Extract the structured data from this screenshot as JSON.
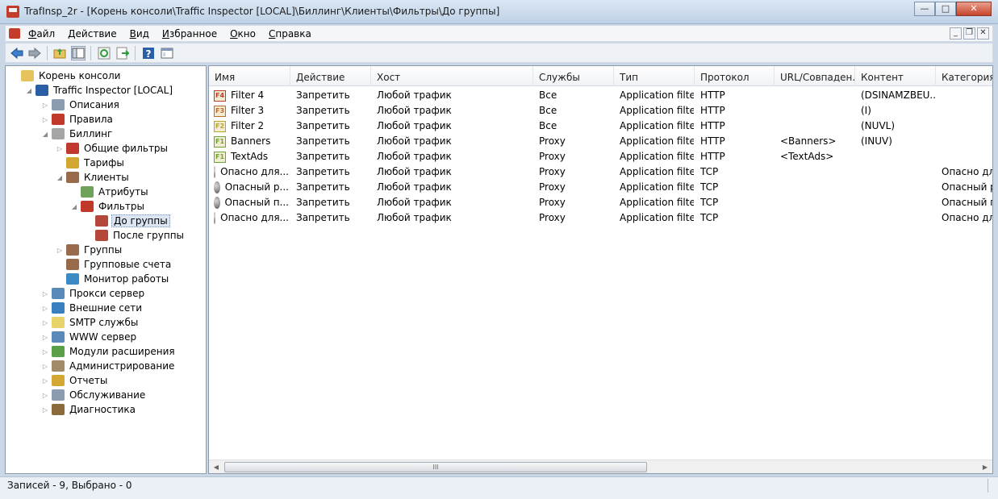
{
  "window": {
    "title": "TrafInsp_2r - [Корень консоли\\Traffic Inspector [LOCAL]\\Биллинг\\Клиенты\\Фильтры\\До группы]",
    "minimize": "—",
    "maximize": "□",
    "close": "✕"
  },
  "menu": {
    "items": [
      {
        "hot": "Ф",
        "rest": "айл"
      },
      {
        "hot": "Д",
        "rest": "ействие"
      },
      {
        "hot": "В",
        "rest": "ид"
      },
      {
        "hot": "И",
        "rest": "збранное"
      },
      {
        "hot": "О",
        "rest": "кно"
      },
      {
        "hot": "С",
        "rest": "правка"
      }
    ],
    "mdi_minimize": "_",
    "mdi_restore": "❐",
    "mdi_close": "✕"
  },
  "toolbar": {
    "icons": [
      "back-icon",
      "forward-icon",
      "up-folder-icon",
      "show-hide-tree-icon",
      "refresh-icon",
      "export-list-icon",
      "help-icon",
      "properties-icon"
    ]
  },
  "tree": {
    "nodes": [
      {
        "label": "Корень консоли",
        "icon": "folder-icon",
        "color": "#e7c35b"
      },
      {
        "label": "Traffic Inspector [LOCAL]",
        "icon": "traffic-inspector-icon",
        "color": "#2a5fa8"
      },
      {
        "label": "Описания",
        "icon": "descriptions-icon",
        "color": "#8c9bb0"
      },
      {
        "label": "Правила",
        "icon": "rules-icon",
        "color": "#c0392b"
      },
      {
        "label": "Биллинг",
        "icon": "billing-icon",
        "color": "#a5a5a5"
      },
      {
        "label": "Общие фильтры",
        "icon": "common-filters-icon",
        "color": "#c0392b"
      },
      {
        "label": "Тарифы",
        "icon": "tariffs-icon",
        "color": "#d4a733"
      },
      {
        "label": "Клиенты",
        "icon": "clients-icon",
        "color": "#9a6b4a"
      },
      {
        "label": "Атрибуты",
        "icon": "attributes-icon",
        "color": "#6fa35b"
      },
      {
        "label": "Фильтры",
        "icon": "filters-icon",
        "color": "#c0392b"
      },
      {
        "label": "До группы",
        "icon": "before-group-icon",
        "color": "#b5463a"
      },
      {
        "label": "После группы",
        "icon": "after-group-icon",
        "color": "#b5463a"
      },
      {
        "label": "Группы",
        "icon": "groups-icon",
        "color": "#9a6b4a"
      },
      {
        "label": "Групповые счета",
        "icon": "group-accounts-icon",
        "color": "#9a6b4a"
      },
      {
        "label": "Монитор работы",
        "icon": "monitor-icon",
        "color": "#3c8ac4"
      },
      {
        "label": "Прокси сервер",
        "icon": "proxy-server-icon",
        "color": "#5a8bb8"
      },
      {
        "label": "Внешние сети",
        "icon": "external-networks-icon",
        "color": "#3a7fc0"
      },
      {
        "label": "SMTP службы",
        "icon": "smtp-icon",
        "color": "#e8d26a"
      },
      {
        "label": "WWW сервер",
        "icon": "www-server-icon",
        "color": "#5a8bb8"
      },
      {
        "label": "Модули расширения",
        "icon": "extension-modules-icon",
        "color": "#5aa04a"
      },
      {
        "label": "Администрирование",
        "icon": "administration-icon",
        "color": "#a08a6a"
      },
      {
        "label": "Отчеты",
        "icon": "reports-icon",
        "color": "#d4a733"
      },
      {
        "label": "Обслуживание",
        "icon": "maintenance-icon",
        "color": "#8c9bb0"
      },
      {
        "label": "Диагностика",
        "icon": "diagnostics-icon",
        "color": "#8a6a3a"
      }
    ]
  },
  "list": {
    "columns": [
      "Имя",
      "Действие",
      "Хост",
      "Службы",
      "Тип",
      "Протокол",
      "URL/Совпаден...",
      "Контент",
      "Категория п"
    ],
    "rows": [
      {
        "icon": "F4",
        "icon_color": "#c0392b",
        "cells": [
          "Filter 4",
          "Запретить",
          "Любой трафик",
          "Все",
          "Application filter",
          "HTTP",
          "",
          "(DSINAMZBEU...",
          ""
        ]
      },
      {
        "icon": "F3",
        "icon_color": "#c26a2b",
        "cells": [
          "Filter 3",
          "Запретить",
          "Любой трафик",
          "Все",
          "Application filter",
          "HTTP",
          "",
          "(I)",
          ""
        ]
      },
      {
        "icon": "F2",
        "icon_color": "#b8a52b",
        "cells": [
          "Filter 2",
          "Запретить",
          "Любой трафик",
          "Все",
          "Application filter",
          "HTTP",
          "",
          "(NUVL)",
          ""
        ]
      },
      {
        "icon": "F1",
        "icon_color": "#6aa82b",
        "cells": [
          "Banners",
          "Запретить",
          "Любой трафик",
          "Proxy",
          "Application filter",
          "HTTP",
          "<Banners>",
          "(INUV)",
          ""
        ]
      },
      {
        "icon": "F1",
        "icon_color": "#6aa82b",
        "cells": [
          "TextAds",
          "Запретить",
          "Любой трафик",
          "Proxy",
          "Application filter",
          "HTTP",
          "<TextAds>",
          "",
          ""
        ]
      },
      {
        "icon": "globe",
        "icon_color": "#5a5a5a",
        "cells": [
          "Опасно для...",
          "Запретить",
          "Любой трафик",
          "Proxy",
          "Application filter",
          "TCP",
          "",
          "",
          "Опасно для"
        ]
      },
      {
        "icon": "globe",
        "icon_color": "#5a5a5a",
        "cells": [
          "Опасный р...",
          "Запретить",
          "Любой трафик",
          "Proxy",
          "Application filter",
          "TCP",
          "",
          "",
          "Опасный р"
        ]
      },
      {
        "icon": "globe",
        "icon_color": "#5a5a5a",
        "cells": [
          "Опасный п...",
          "Запретить",
          "Любой трафик",
          "Proxy",
          "Application filter",
          "TCP",
          "",
          "",
          "Опасный п"
        ]
      },
      {
        "icon": "globe",
        "icon_color": "#5a5a5a",
        "cells": [
          "Опасно для...",
          "Запретить",
          "Любой трафик",
          "Proxy",
          "Application filter",
          "TCP",
          "",
          "",
          "Опасно для"
        ]
      }
    ],
    "scroll_grip": "III"
  },
  "status": {
    "text": "Записей - 9,   Выбрано - 0"
  }
}
